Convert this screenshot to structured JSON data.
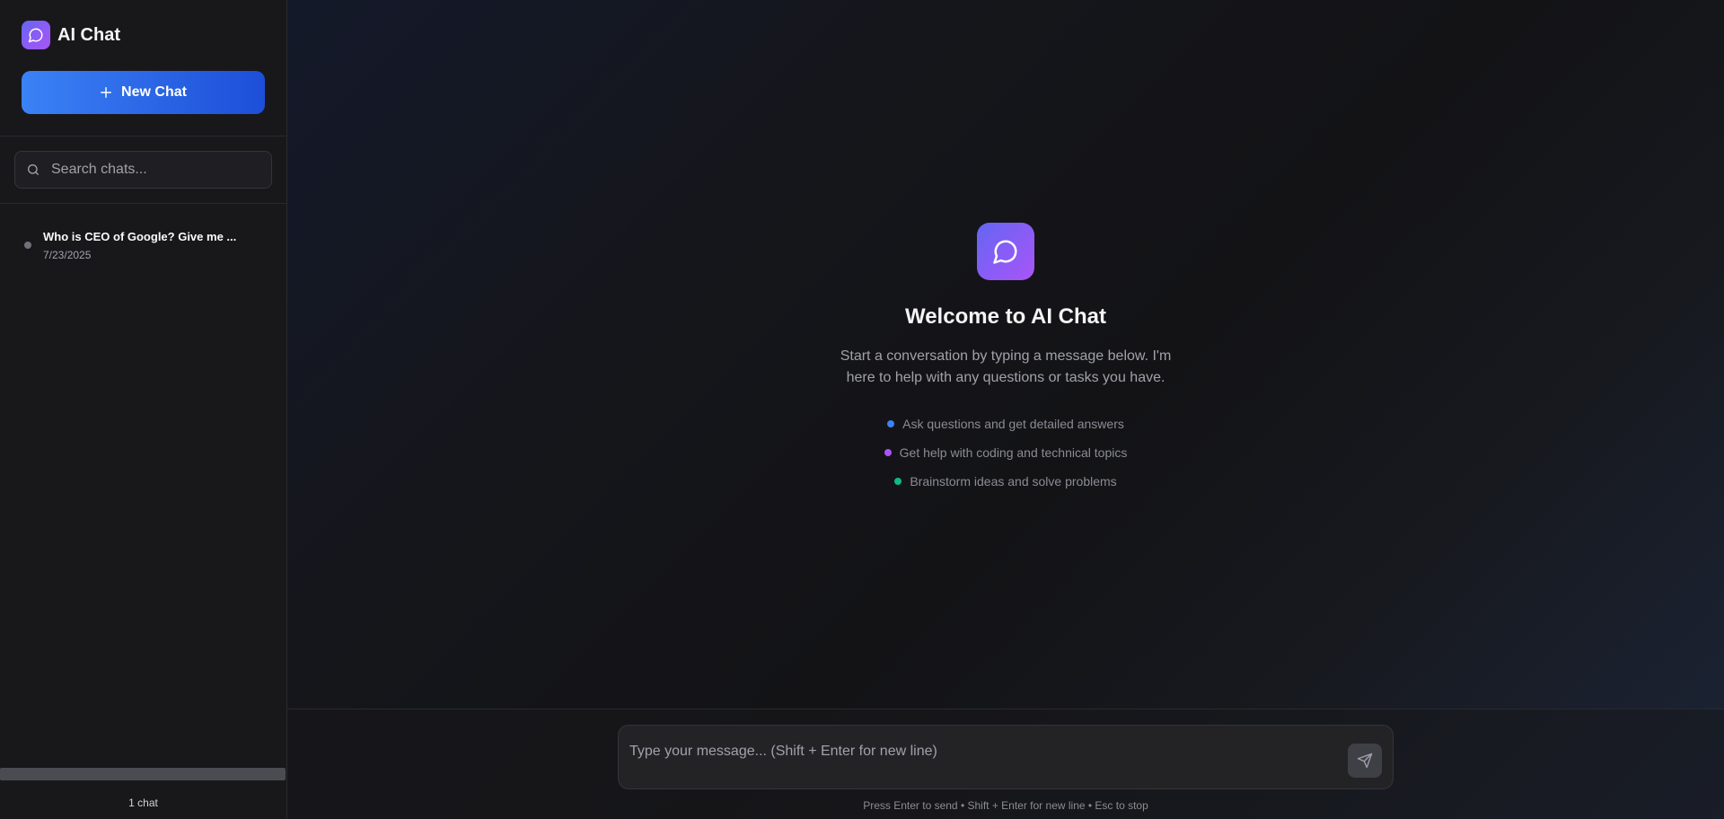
{
  "sidebar": {
    "brand_title": "AI Chat",
    "new_chat_label": "New Chat",
    "search_placeholder": "Search chats...",
    "chats": [
      {
        "title": "Who is CEO of Google? Give me ...",
        "date": "7/23/2025"
      }
    ],
    "chat_count": "1 chat"
  },
  "main": {
    "welcome_title": "Welcome to AI Chat",
    "welcome_subtitle": "Start a conversation by typing a message below. I'm here to help with any questions or tasks you have.",
    "features": [
      {
        "label": "Ask questions and get detailed answers",
        "color": "#3b82f6"
      },
      {
        "label": "Get help with coding and technical topics",
        "color": "#a855f7"
      },
      {
        "label": "Brainstorm ideas and solve problems",
        "color": "#10b981"
      }
    ]
  },
  "composer": {
    "placeholder": "Type your message... (Shift + Enter for new line)",
    "hint": "Press Enter to send • Shift + Enter for new line • Esc to stop"
  },
  "icons": {
    "brand": "chat-bubble-icon",
    "new_chat": "plus-icon",
    "search": "search-icon",
    "send": "send-icon"
  }
}
